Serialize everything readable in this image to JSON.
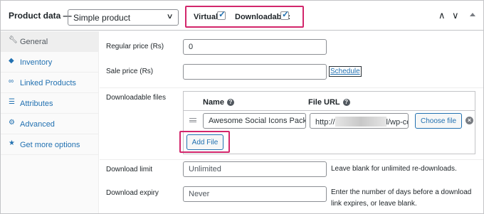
{
  "header": {
    "title": "Product data —",
    "product_type": "Simple product",
    "virtual_label": "Virtual:",
    "virtual_checked": true,
    "downloadable_label": "Downloadable:",
    "downloadable_checked": true,
    "icons": [
      "chevron-up-icon",
      "chevron-down-icon",
      "collapse-triangle-icon"
    ]
  },
  "sidebar": {
    "items": [
      {
        "label": "General",
        "icon": "wrench-icon",
        "active": true
      },
      {
        "label": "Inventory",
        "icon": "tag-icon",
        "active": false
      },
      {
        "label": "Linked Products",
        "icon": "link-icon",
        "active": false
      },
      {
        "label": "Attributes",
        "icon": "list-icon",
        "active": false
      },
      {
        "label": "Advanced",
        "icon": "gear-icon",
        "active": false
      },
      {
        "label": "Get more options",
        "icon": "plugin-icon",
        "active": false
      }
    ]
  },
  "general": {
    "regular_price_label": "Regular price (Rs)",
    "regular_price_value": "0",
    "sale_price_label": "Sale price (Rs)",
    "sale_price_value": "",
    "schedule_label": "Schedule",
    "downloadable_files_label": "Downloadable files",
    "files_table": {
      "name_header": "Name",
      "url_header": "File URL",
      "rows": [
        {
          "name": "Awesome Social Icons Pack",
          "url_prefix": "http://",
          "url_suffix": "l/wp-co"
        }
      ],
      "choose_file_label": "Choose file",
      "add_file_label": "Add File"
    },
    "download_limit_label": "Download limit",
    "download_limit_placeholder": "Unlimited",
    "download_limit_desc": "Leave blank for unlimited re-downloads.",
    "download_expiry_label": "Download expiry",
    "download_expiry_placeholder": "Never",
    "download_expiry_desc_1": "Enter the number of days before a download",
    "download_expiry_desc_2": "link expires, or leave blank."
  },
  "colors": {
    "highlight": "#d2266b",
    "link": "#2271b1"
  }
}
